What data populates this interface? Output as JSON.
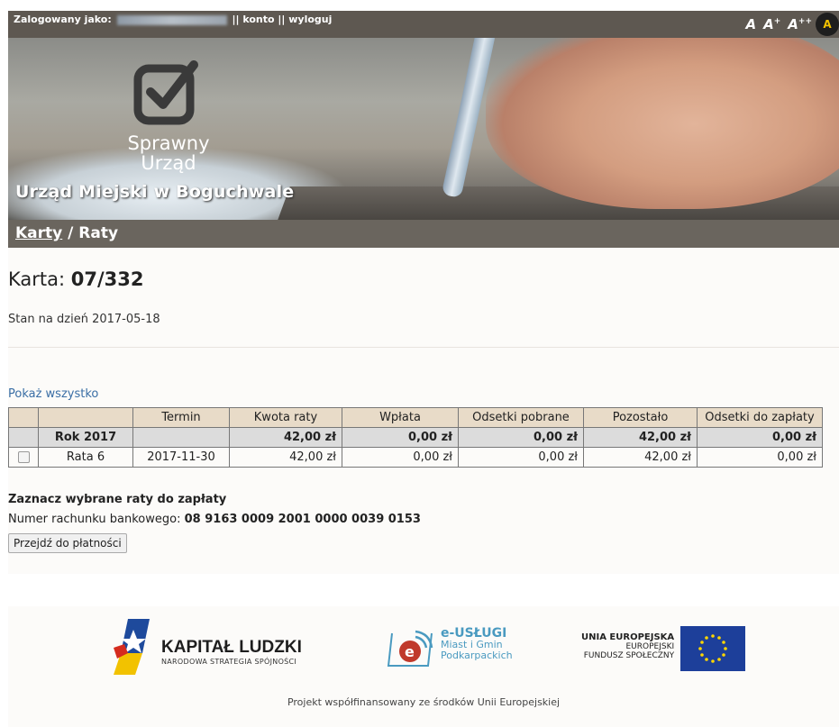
{
  "header": {
    "login_label": "Zalogowany jako:",
    "sep1": " || ",
    "account_link": "konto",
    "sep2": " || ",
    "logout_link": "wyloguj",
    "font_normal": "A",
    "font_large": "A",
    "font_large_sup": "+",
    "font_xlarge": "A",
    "font_xlarge_sup": "++",
    "contrast": "A"
  },
  "banner": {
    "logo_line1": "Sprawny",
    "logo_line2": "Urząd",
    "office_name": "Urząd Miejski w Boguchwale"
  },
  "breadcrumb": {
    "link": "Karty",
    "separator": " / ",
    "current": "Raty"
  },
  "card": {
    "label": "Karta: ",
    "number": "07/332",
    "status_date": "Stan na dzień 2017-05-18"
  },
  "show_all": "Pokaż wszystko",
  "table": {
    "headers": [
      "",
      "",
      "Termin",
      "Kwota raty",
      "Wpłata",
      "Odsetki pobrane",
      "Pozostało",
      "Odsetki do zapłaty"
    ],
    "year_row": {
      "label": "Rok 2017",
      "termin": "",
      "kwota": "42,00 zł",
      "wplata": "0,00 zł",
      "odsetki_pobrane": "0,00 zł",
      "pozostalo": "42,00 zł",
      "odsetki_do_zaplaty": "0,00 zł"
    },
    "rows": [
      {
        "label": "Rata 6",
        "termin": "2017-11-30",
        "kwota": "42,00 zł",
        "wplata": "0,00 zł",
        "odsetki_pobrane": "0,00 zł",
        "pozostalo": "42,00 zł",
        "odsetki_do_zaplaty": "0,00 zł"
      }
    ]
  },
  "payment": {
    "select_label": "Zaznacz wybrane raty do zapłaty",
    "bank_label": "Numer rachunku bankowego: ",
    "bank_number": "08 9163 0009 2001 0000 0039 0153",
    "button": "Przejdź do płatności"
  },
  "footer": {
    "kapital_title": "KAPITAŁ LUDZKI",
    "kapital_sub": "NARODOWA STRATEGIA SPÓJNOŚCI",
    "eus_title": "e-USŁUGI",
    "eus_line2": "Miast i Gmin",
    "eus_line3": "Podkarpackich",
    "ue_line1": "UNIA EUROPEJSKA",
    "ue_line2": "EUROPEJSKI",
    "ue_line3": "FUNDUSZ SPOŁECZNY",
    "project": "Projekt współfinansowany ze środków Unii Europejskiej"
  },
  "colors": {
    "topbar": "#5e5851",
    "breadcrumb_bar": "#6a655e",
    "table_header": "#e8dbc8",
    "link": "#3a6ea5"
  }
}
